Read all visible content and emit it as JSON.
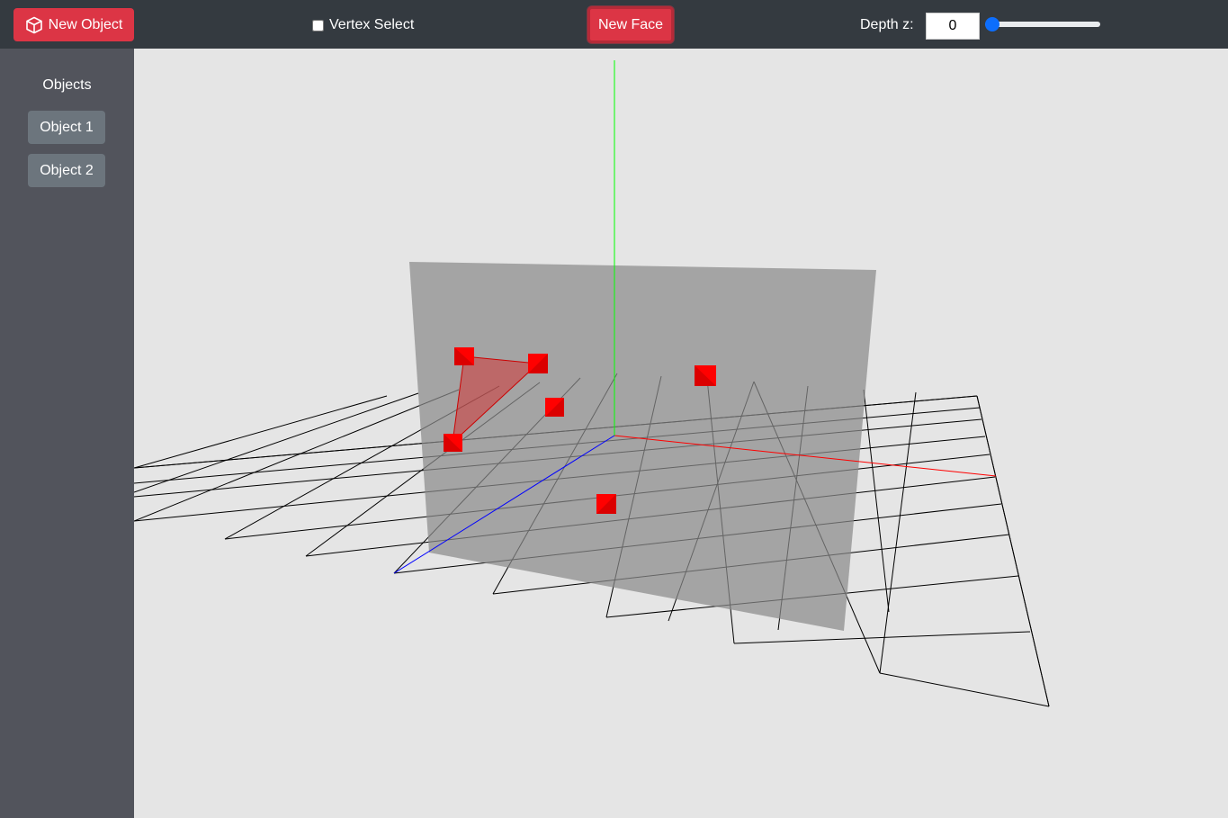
{
  "toolbar": {
    "new_object_label": "New Object",
    "vertex_select_label": "Vertex Select",
    "vertex_select_checked": false,
    "new_face_label": "New Face",
    "depth_label": "Depth z:",
    "depth_value": "0",
    "depth_slider_value": 0
  },
  "icons": {
    "new_object": "cube-icon"
  },
  "sidebar": {
    "title": "Objects",
    "items": [
      {
        "label": "Object 1"
      },
      {
        "label": "Object 2"
      }
    ]
  },
  "colors": {
    "toolbar_bg": "#343a40",
    "sidebar_bg": "#52545c",
    "accent_red": "#dc3545",
    "secondary_button": "#6c757d",
    "viewport_bg": "#e5e5e5",
    "x_axis": "#ff0000",
    "y_axis": "#00ff00",
    "z_axis": "#0000ff",
    "vertex": "#ff0000",
    "plane": "#999999"
  }
}
